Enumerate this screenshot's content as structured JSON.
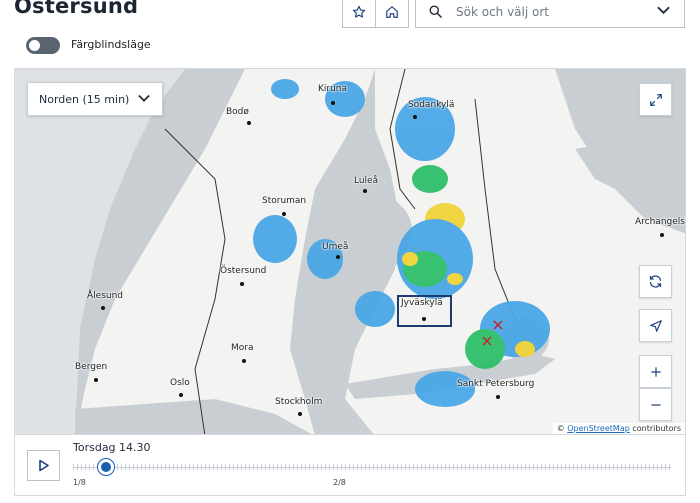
{
  "header": {
    "title": "Östersund",
    "favorite_icon": "star-icon",
    "home_icon": "home-icon"
  },
  "search": {
    "placeholder": "Sök och välj ort",
    "icon": "search-icon"
  },
  "colorblind_toggle": {
    "label": "Färgblindsläge",
    "enabled": false
  },
  "map": {
    "region_select": "Norden (15 min)",
    "cities": [
      {
        "name": "Kiruna"
      },
      {
        "name": "Bodø"
      },
      {
        "name": "Sodankylä"
      },
      {
        "name": "Luleå"
      },
      {
        "name": "Storuman"
      },
      {
        "name": "Umeå"
      },
      {
        "name": "Östersund"
      },
      {
        "name": "Ålesund"
      },
      {
        "name": "Jyväskylä"
      },
      {
        "name": "Mora"
      },
      {
        "name": "Bergen"
      },
      {
        "name": "Oslo"
      },
      {
        "name": "Stockholm"
      },
      {
        "name": "Sankt Petersburg"
      },
      {
        "name": "Archangelsk"
      }
    ],
    "attribution": {
      "prefix": "©",
      "link": "OpenStreetMap",
      "suffix": "contributors"
    },
    "controls": {
      "fullscreen": "fullscreen-icon",
      "refresh": "refresh-icon",
      "locate": "locate-icon",
      "zoom_in": "+",
      "zoom_out": "−"
    },
    "colors": {
      "land": "#f3f3f1",
      "water": "#c9ced3",
      "outer": "#b9bfc6",
      "radar_light": "#4aa7e6",
      "radar_mid": "#2fbf6a",
      "radar_high": "#f0d43a",
      "highlight": "#1d3b73"
    }
  },
  "timeline": {
    "time_label": "Torsdag 14.30",
    "position": "1/8",
    "tick_labels": [
      "1/8",
      "2/8"
    ],
    "accent": "#1b5fb0"
  }
}
